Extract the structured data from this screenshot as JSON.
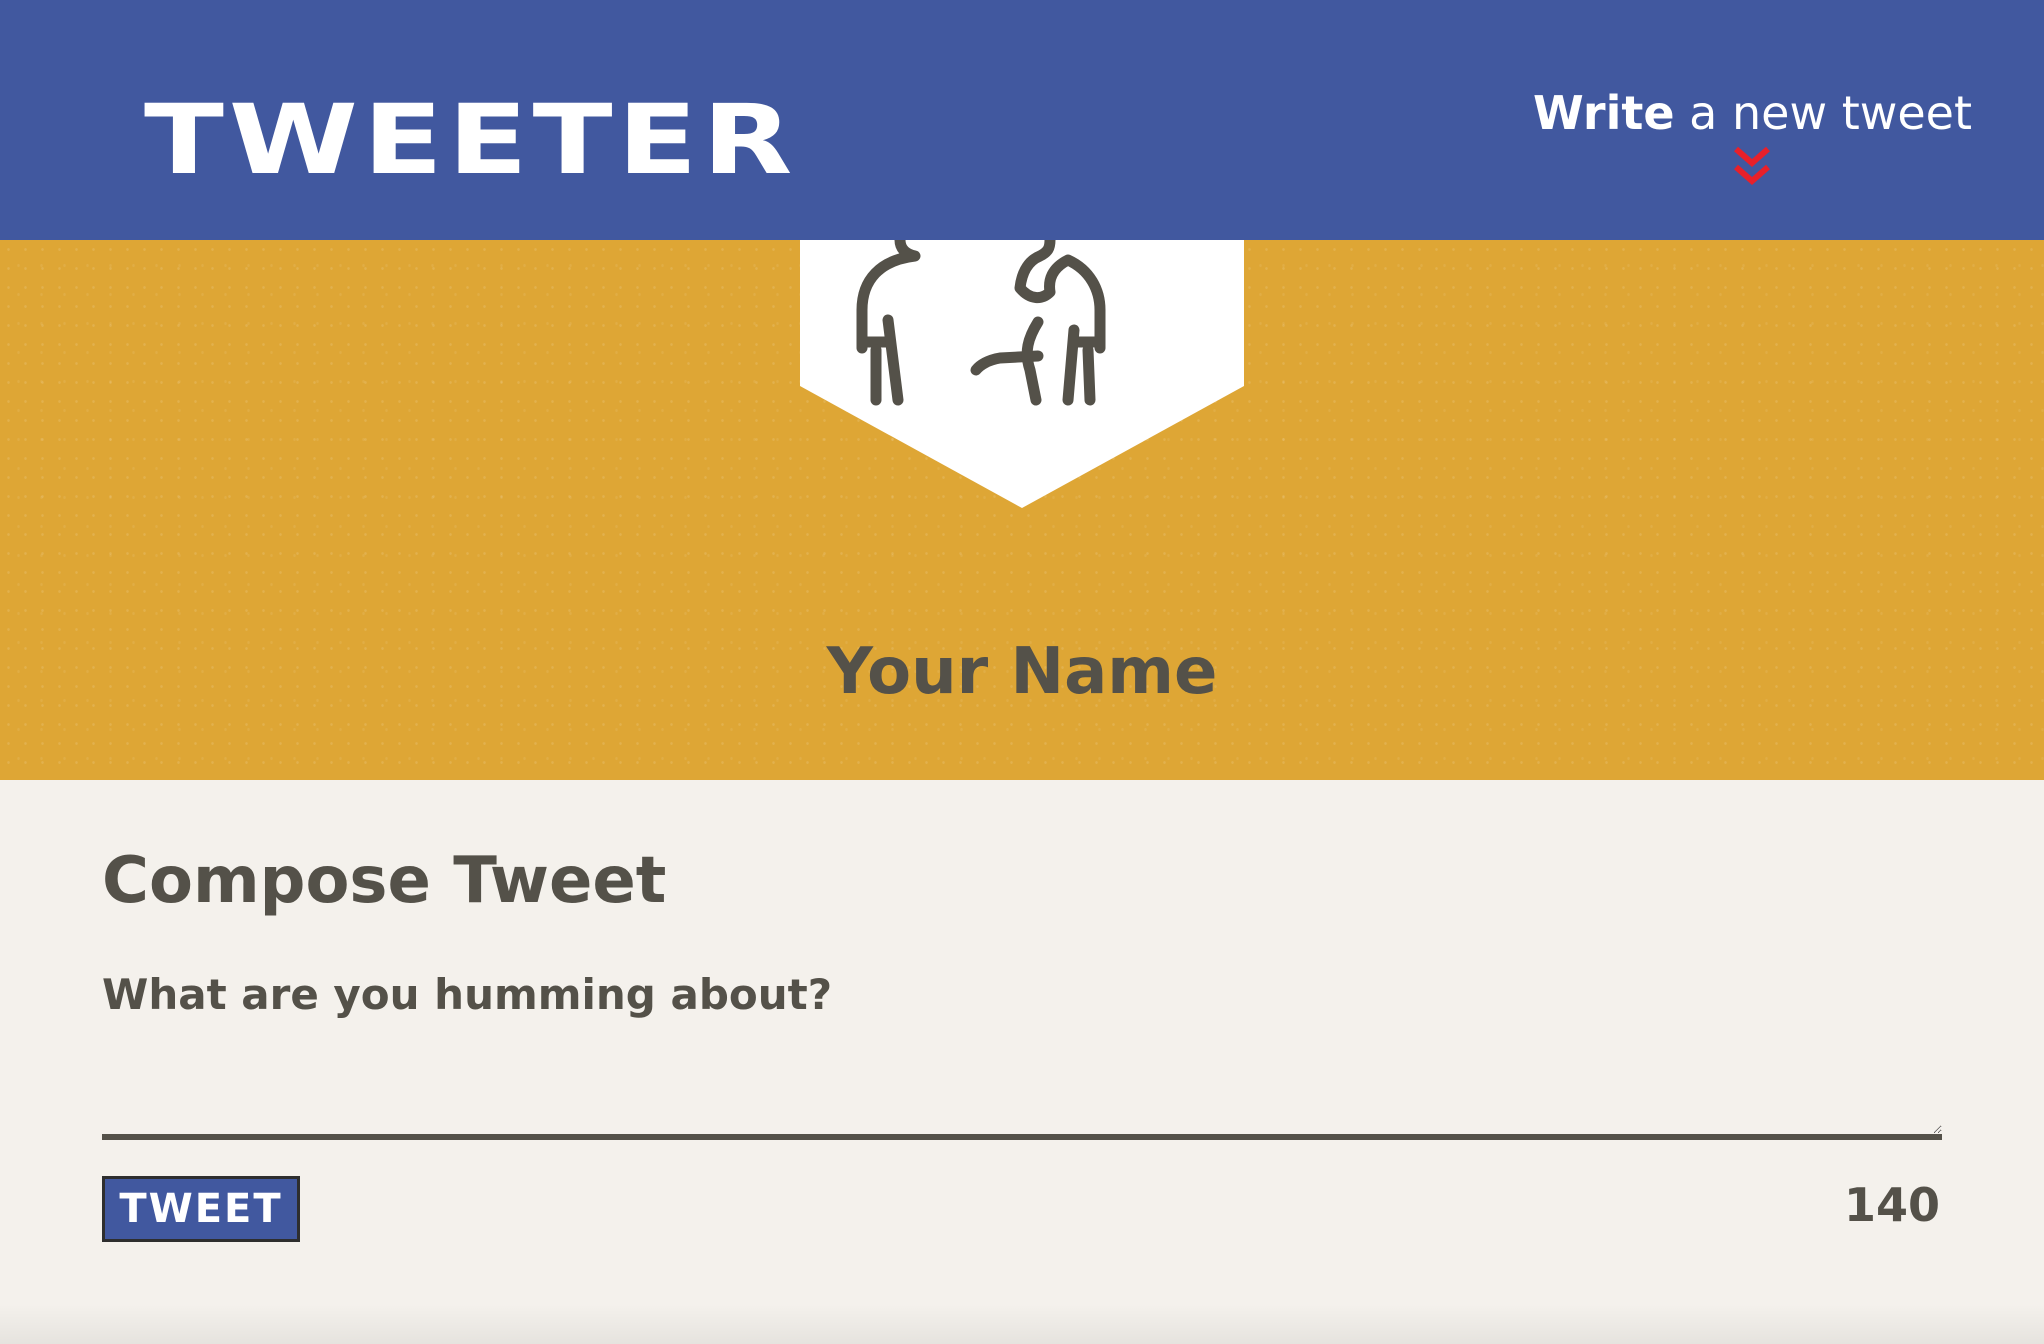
{
  "nav": {
    "logo": "TWEETER",
    "write_strong": "Write",
    "write_rest": " a new tweet",
    "chevron_icon": "double-chevron-down-icon",
    "chevron_color": "#e8202a"
  },
  "profile": {
    "avatar_icon": "user-avatar-icon",
    "name": "Your Name"
  },
  "compose": {
    "title": "Compose Tweet",
    "textarea_placeholder": "What are you humming about?",
    "textarea_value": "",
    "tweet_button_label": "TWEET",
    "char_counter": "140"
  },
  "colors": {
    "nav_background": "#41589f",
    "hero_background": "#dea635",
    "page_background": "#f4f1ec",
    "text": "#545149",
    "accent_red": "#e8202a"
  }
}
